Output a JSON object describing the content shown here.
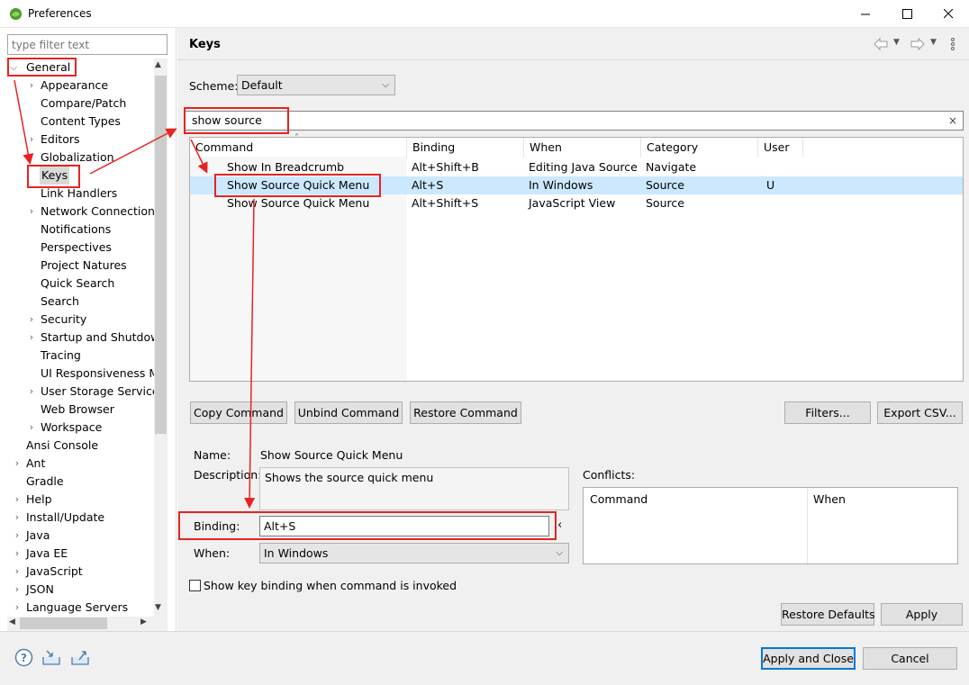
{
  "window": {
    "title": "Preferences",
    "minimize_glyph": "—",
    "maximize_glyph": "☐",
    "close_glyph": "✕"
  },
  "sidebar": {
    "filter_placeholder": "type filter text",
    "items": [
      {
        "label": "General",
        "level": 0,
        "expander": "open"
      },
      {
        "label": "Appearance",
        "level": 1,
        "expander": "closed"
      },
      {
        "label": "Compare/Patch",
        "level": 1,
        "expander": "none"
      },
      {
        "label": "Content Types",
        "level": 1,
        "expander": "none"
      },
      {
        "label": "Editors",
        "level": 1,
        "expander": "closed"
      },
      {
        "label": "Globalization",
        "level": 1,
        "expander": "none"
      },
      {
        "label": "Keys",
        "level": 1,
        "expander": "none",
        "selected": true
      },
      {
        "label": "Link Handlers",
        "level": 1,
        "expander": "none"
      },
      {
        "label": "Network Connections",
        "level": 1,
        "expander": "closed"
      },
      {
        "label": "Notifications",
        "level": 1,
        "expander": "none"
      },
      {
        "label": "Perspectives",
        "level": 1,
        "expander": "none"
      },
      {
        "label": "Project Natures",
        "level": 1,
        "expander": "none"
      },
      {
        "label": "Quick Search",
        "level": 1,
        "expander": "none"
      },
      {
        "label": "Search",
        "level": 1,
        "expander": "none"
      },
      {
        "label": "Security",
        "level": 1,
        "expander": "closed"
      },
      {
        "label": "Startup and Shutdown",
        "level": 1,
        "expander": "closed"
      },
      {
        "label": "Tracing",
        "level": 1,
        "expander": "none"
      },
      {
        "label": "UI Responsiveness Monitoring",
        "level": 1,
        "expander": "none"
      },
      {
        "label": "User Storage Service",
        "level": 1,
        "expander": "closed"
      },
      {
        "label": "Web Browser",
        "level": 1,
        "expander": "none"
      },
      {
        "label": "Workspace",
        "level": 1,
        "expander": "closed"
      },
      {
        "label": "Ansi Console",
        "level": 0,
        "expander": "none"
      },
      {
        "label": "Ant",
        "level": 0,
        "expander": "closed"
      },
      {
        "label": "Gradle",
        "level": 0,
        "expander": "none"
      },
      {
        "label": "Help",
        "level": 0,
        "expander": "closed"
      },
      {
        "label": "Install/Update",
        "level": 0,
        "expander": "closed"
      },
      {
        "label": "Java",
        "level": 0,
        "expander": "closed"
      },
      {
        "label": "Java EE",
        "level": 0,
        "expander": "closed"
      },
      {
        "label": "JavaScript",
        "level": 0,
        "expander": "closed"
      },
      {
        "label": "JSON",
        "level": 0,
        "expander": "closed"
      },
      {
        "label": "Language Servers",
        "level": 0,
        "expander": "closed"
      }
    ]
  },
  "page": {
    "title": "Keys",
    "scheme_label": "Scheme:",
    "scheme_value": "Default",
    "search_value": "show source",
    "table": {
      "columns": [
        "Command",
        "Binding",
        "When",
        "Category",
        "User"
      ],
      "rows": [
        {
          "command": "Show In Breadcrumb",
          "binding": "Alt+Shift+B",
          "when": "Editing Java Source",
          "category": "Navigate",
          "user": ""
        },
        {
          "command": "Show Source Quick Menu",
          "binding": "Alt+S",
          "when": "In Windows",
          "category": "Source",
          "user": "U"
        },
        {
          "command": "Show Source Quick Menu",
          "binding": "Alt+Shift+S",
          "when": "JavaScript View",
          "category": "Source",
          "user": ""
        }
      ]
    },
    "buttons": {
      "copy_command": "Copy Command",
      "unbind_command": "Unbind Command",
      "restore_command": "Restore Command",
      "filters": "Filters...",
      "export_csv": "Export CSV..."
    },
    "details": {
      "name_label": "Name:",
      "name_value": "Show Source Quick Menu",
      "description_label": "Description:",
      "description_value": "Shows the source quick menu",
      "binding_label": "Binding:",
      "binding_value": "Alt+S",
      "when_label": "When:",
      "when_value": "In Windows",
      "conflicts_label": "Conflicts:",
      "conflicts_columns": [
        "Command",
        "When"
      ],
      "show_binding_checkbox": "Show key binding when command is invoked"
    },
    "restore_defaults": "Restore Defaults",
    "apply": "Apply"
  },
  "footer": {
    "apply_and_close": "Apply and Close",
    "cancel": "Cancel"
  },
  "colors": {
    "highlight_red": "#e8231f",
    "selection_blue": "#cce8ff",
    "default_button_border": "#0078d7"
  }
}
